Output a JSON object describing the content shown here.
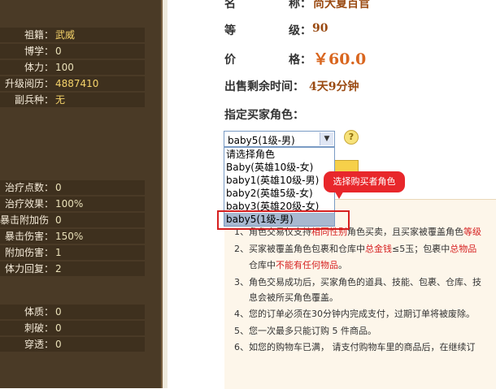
{
  "left_panel": {
    "stats_a": [
      {
        "label": "祖籍：",
        "value": "武威",
        "yellow": true
      },
      {
        "label": "博学：",
        "value": "0",
        "yellow": false
      },
      {
        "label": "体力：",
        "value": "100",
        "yellow": false
      },
      {
        "label": "升级阅历：",
        "value": "4887410",
        "yellow": true
      },
      {
        "label": "副兵种：",
        "value": "无",
        "yellow": true
      }
    ],
    "stats_b": [
      {
        "label": "治疗点数：",
        "value": "0"
      },
      {
        "label": "治疗效果：",
        "value": "100%"
      },
      {
        "label": "暴击附加伤害：",
        "value": "0"
      },
      {
        "label": "暴击伤害：",
        "value": "150%"
      },
      {
        "label": "附加伤害：",
        "value": "1"
      },
      {
        "label": "体力回复：",
        "value": "2"
      }
    ],
    "stats_c": [
      {
        "label": "体质：",
        "value": "0"
      },
      {
        "label": "刺破：",
        "value": "0"
      },
      {
        "label": "穿透：",
        "value": "0"
      }
    ]
  },
  "item": {
    "name_label_left": "名",
    "name_label_right": "称：",
    "name_value": "尚大夏百官",
    "level_label_left": "等",
    "level_label_right": "级：",
    "level_value": "90",
    "price_label_left": "价",
    "price_label_right": "格：",
    "price_value": "￥60.0",
    "time_label": "出售剩余时间：",
    "time_value": "4天9分钟",
    "buyer_label": "指定买家角色："
  },
  "select": {
    "selected": "baby5(1级-男)",
    "arrow": "▼",
    "help": "?",
    "options": [
      "请选择角色",
      "Baby(英雄10级-女)",
      "baby1(英雄10级-男)",
      "baby2(英雄5级-女)",
      "baby3(英雄20级-女)",
      "baby5(1级-男)"
    ]
  },
  "callout": "选择购买者角色",
  "notes": {
    "n1a": "1、角色交易仅支持",
    "n1b": "相同性别",
    "n1c": "角色买卖，且买家被覆盖角色",
    "n1d": "等级",
    "n2a": "2、买家被覆盖角色包裹和仓库中",
    "n2b": "总金钱",
    "n2c": "≤5玉；包裹中",
    "n2d": "总物品",
    "n2e_a": "仓库中",
    "n2e_b": "不能有任何物品",
    "n2e_c": "。",
    "n3a": "3、角色交易成功后，买家角色的道具、技能、包裹、仓库、技",
    "n3b": "息会被所买角色覆盖。",
    "n4": "4、您的订单必须在30分钟内完成支付，过期订单将被废除。",
    "n5": "5、您一次最多只能订购 5 件商品。",
    "n6": "6、如您的购物车已满， 请支付购物车里的商品后，在继续订"
  },
  "colors": {
    "panel": "#4a3a26",
    "accent_red": "#d62020",
    "price": "#d9661f"
  }
}
